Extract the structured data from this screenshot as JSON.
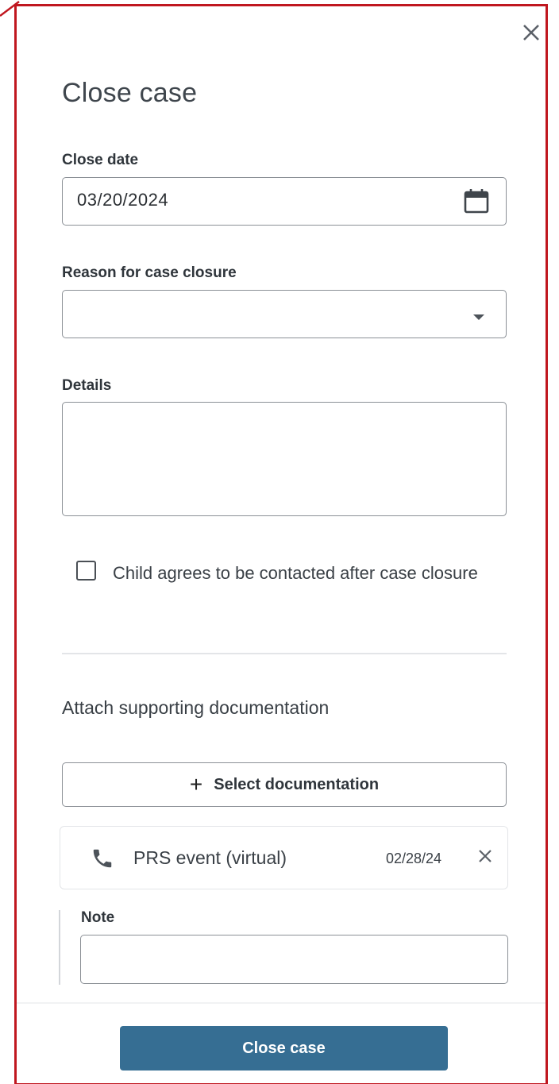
{
  "dialog": {
    "title": "Close case",
    "close_icon": "close-icon"
  },
  "form": {
    "close_date": {
      "label": "Close date",
      "value": "03/20/2024",
      "icon": "calendar-icon"
    },
    "reason": {
      "label": "Reason for case closure",
      "value": "",
      "icon": "dropdown-arrow-icon"
    },
    "details": {
      "label": "Details",
      "value": ""
    },
    "consent": {
      "label": "Child agrees to be contacted after case closure",
      "checked": false
    }
  },
  "documentation": {
    "section_title": "Attach supporting documentation",
    "select_label": "Select documentation",
    "items": [
      {
        "icon": "phone-icon",
        "title": "PRS event (virtual)",
        "date": "02/28/24",
        "note_label": "Note",
        "note_value": ""
      }
    ]
  },
  "footer": {
    "primary_label": "Close case",
    "primary_color": "#366e93"
  },
  "colors": {
    "frame_border": "#c0171f"
  }
}
